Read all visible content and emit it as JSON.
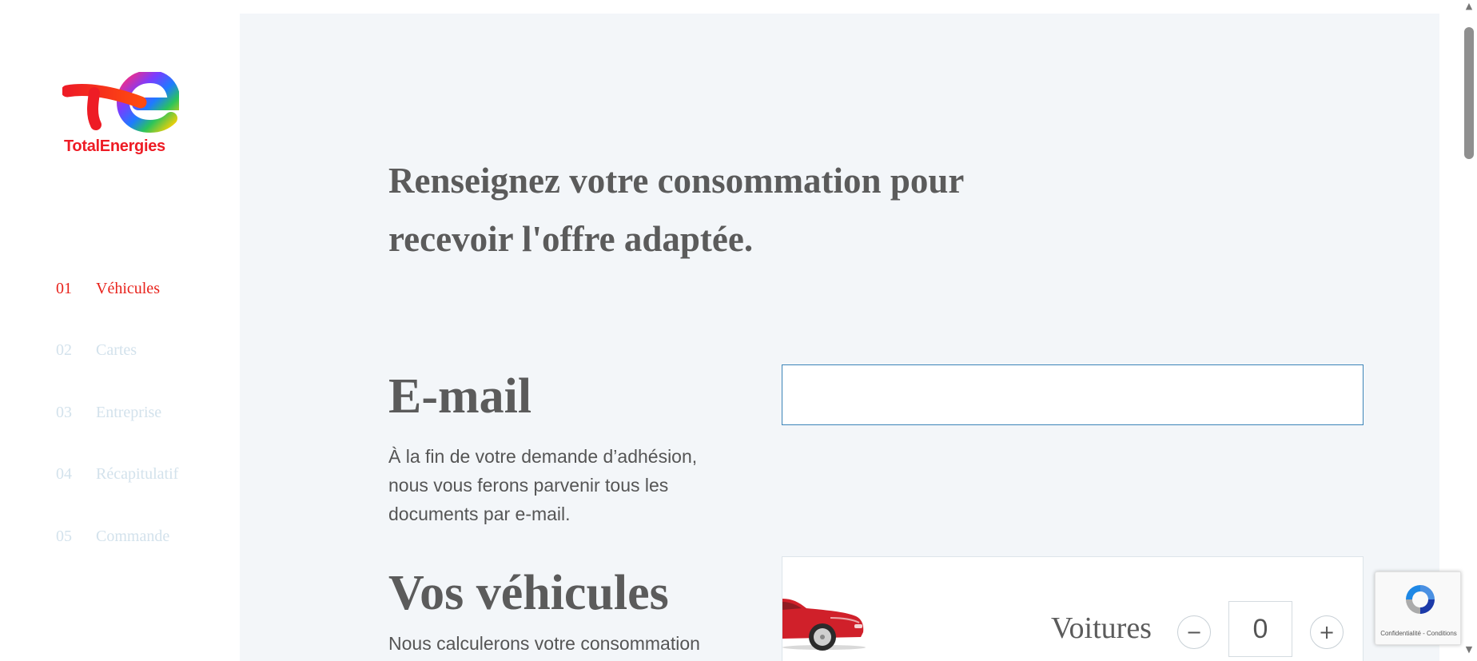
{
  "brand": {
    "name": "TotalEnergies",
    "color": "#ee1c25"
  },
  "steps": [
    {
      "num": "01",
      "label": "Véhicules",
      "active": true
    },
    {
      "num": "02",
      "label": "Cartes",
      "active": false
    },
    {
      "num": "03",
      "label": "Entreprise",
      "active": false
    },
    {
      "num": "04",
      "label": "Récapitulatif",
      "active": false
    },
    {
      "num": "05",
      "label": "Commande",
      "active": false
    }
  ],
  "colors": {
    "active_step": "#e8221b",
    "inactive_step": "#d3e2ec",
    "panel_bg": "#f3f6f9",
    "input_border": "#3b84b8"
  },
  "main": {
    "headline": "Renseignez votre consommation pour recevoir l'offre adaptée.",
    "email": {
      "title": "E-mail",
      "description": "À la fin de votre demande d’adhésion, nous vous ferons parvenir tous les documents par e-mail.",
      "value": ""
    },
    "vehicles": {
      "title": "Vos véhicules",
      "description": "Nous calculerons votre consommation",
      "items": [
        {
          "label": "Voitures",
          "count": "0",
          "icon": "red-car-icon"
        }
      ],
      "decrement_symbol": "−",
      "increment_symbol": "+"
    }
  },
  "recaptcha": {
    "text": "Confidentialité - Conditions",
    "icon": "recaptcha-icon"
  }
}
